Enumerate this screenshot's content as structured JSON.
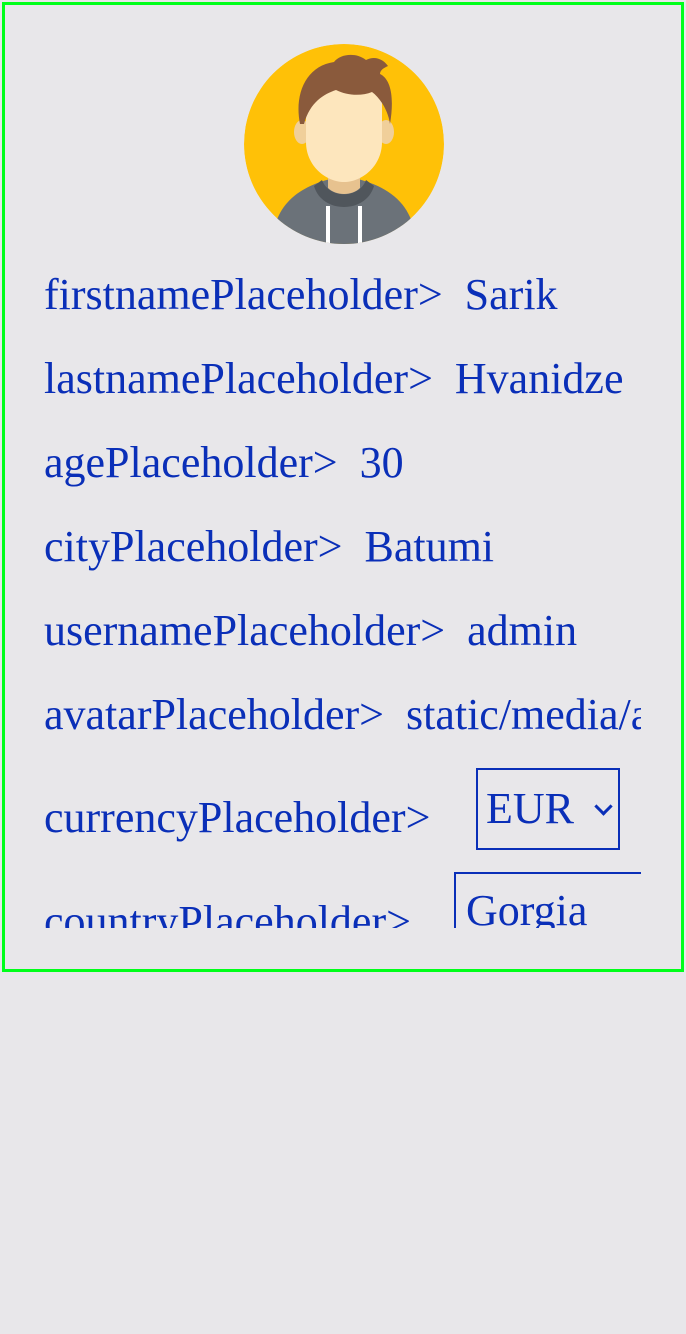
{
  "profile": {
    "fields": [
      {
        "label": "firstnamePlaceholder>",
        "value": "Sarik"
      },
      {
        "label": "lastnamePlaceholder>",
        "value": "Hvanidze"
      },
      {
        "label": "agePlaceholder>",
        "value": "30"
      },
      {
        "label": "cityPlaceholder>",
        "value": "Batumi"
      },
      {
        "label": "usernamePlaceholder>",
        "value": "admin"
      },
      {
        "label": "avatarPlaceholder>",
        "value": "static/media/avatar.png"
      }
    ],
    "currency": {
      "label": "currencyPlaceholder>",
      "selected": "EUR"
    },
    "country": {
      "label": "countryPlaceholder>",
      "value": "Gorgia"
    }
  },
  "colors": {
    "text": "#0a2fb8",
    "background": "#e8e7ea",
    "frame_border": "#00ff1a",
    "avatar_bg": "#ffc107"
  },
  "icons": {
    "avatar": "user-avatar-icon",
    "dropdown": "chevron-down-icon"
  }
}
